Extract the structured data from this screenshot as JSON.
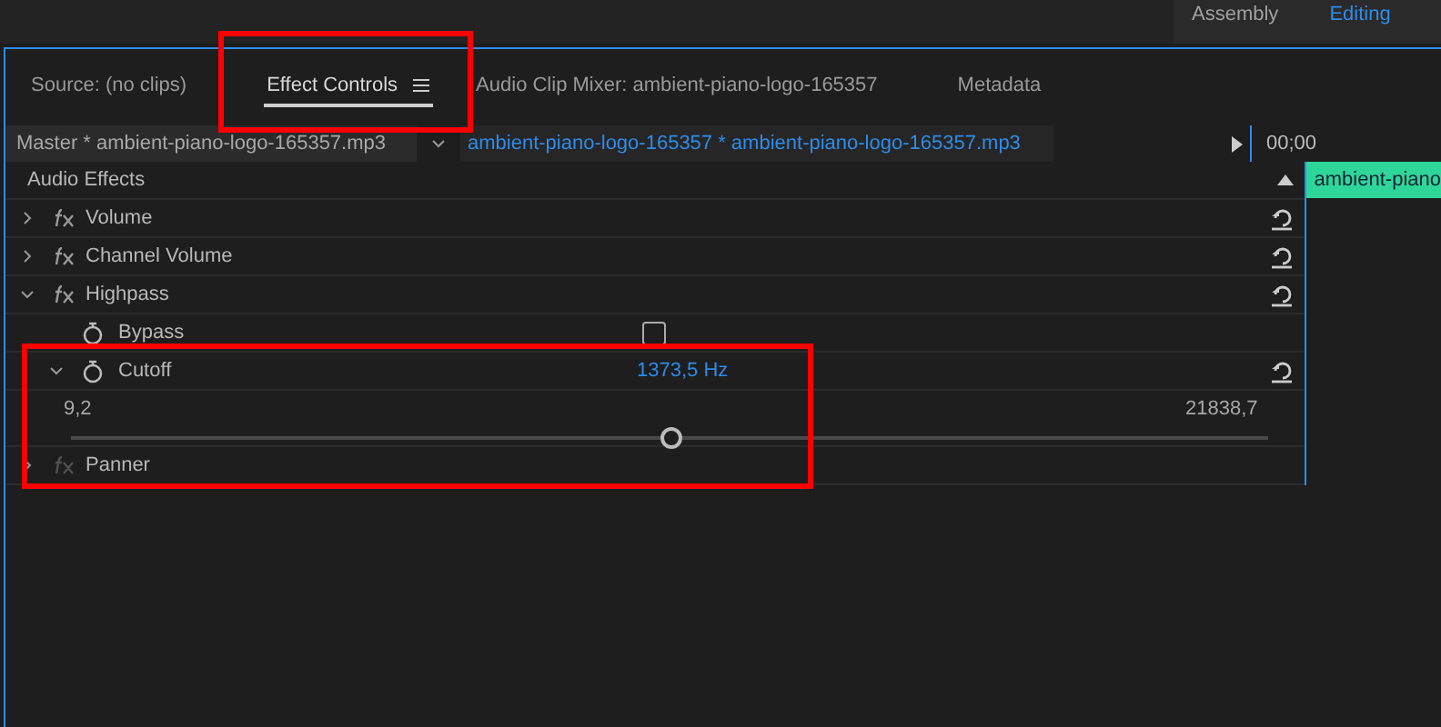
{
  "workspaces": [
    {
      "label": "Assembly",
      "selected": false
    },
    {
      "label": "Editing",
      "selected": true
    }
  ],
  "tabs": [
    {
      "label": "Source: (no clips)",
      "selected": false,
      "menu": false
    },
    {
      "label": "Effect Controls",
      "selected": true,
      "menu": true
    },
    {
      "label": "Audio Clip Mixer: ambient-piano-logo-165357",
      "selected": false,
      "menu": false
    },
    {
      "label": "Metadata",
      "selected": false,
      "menu": false
    }
  ],
  "header": {
    "master": "Master * ambient-piano-logo-165357.mp3",
    "clip": "ambient-piano-logo-165357 * ambient-piano-logo-165357.mp3"
  },
  "timeline": {
    "time": "00;00",
    "clip": "ambient-piano"
  },
  "section": "Audio Effects",
  "rows": [
    {
      "kind": "effect",
      "label": "Volume",
      "expanded": false,
      "enabled": true,
      "reset": true
    },
    {
      "kind": "effect",
      "label": "Channel Volume",
      "expanded": false,
      "enabled": true,
      "reset": true
    },
    {
      "kind": "effect",
      "label": "Highpass",
      "expanded": true,
      "enabled": true,
      "reset": true
    },
    {
      "kind": "checkbox",
      "label": "Bypass",
      "checked": false
    },
    {
      "kind": "param",
      "label": "Cutoff",
      "value": "1373,5 Hz",
      "expanded": true,
      "reset": true,
      "min": "9,2",
      "max": "21838,7",
      "level": 0.5
    },
    {
      "kind": "effect",
      "label": "Panner",
      "expanded": false,
      "enabled": false,
      "reset": false
    }
  ]
}
